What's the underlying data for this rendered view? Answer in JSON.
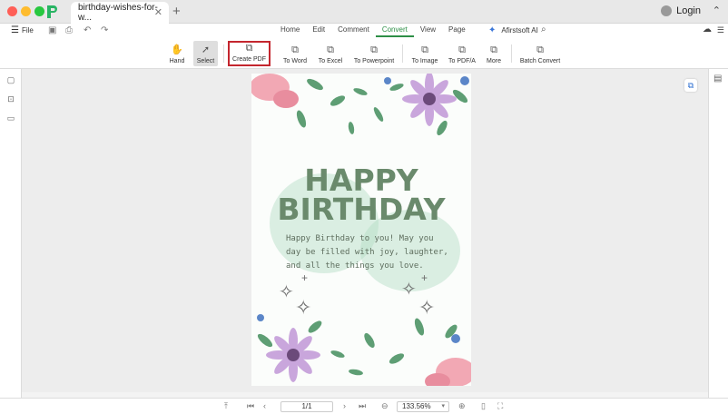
{
  "window": {
    "tab_title": "birthday-wishes-for-w...",
    "tab_close": "✕",
    "new_tab": "+",
    "login_label": "Login"
  },
  "menubar": {
    "file_label": "File",
    "tabs": [
      "Home",
      "Edit",
      "Comment",
      "Convert",
      "View",
      "Page"
    ],
    "active_tab": "Convert",
    "ai_label": "Afirstsoft AI"
  },
  "toolbar": {
    "tools": [
      {
        "label": "Hand",
        "icon": "hand-icon"
      },
      {
        "label": "Select",
        "icon": "cursor-icon"
      },
      {
        "label": "Create PDF",
        "icon": "create-pdf-icon"
      },
      {
        "label": "To Word",
        "icon": "word-icon"
      },
      {
        "label": "To Excel",
        "icon": "excel-icon"
      },
      {
        "label": "To Powerpoint",
        "icon": "powerpoint-icon"
      },
      {
        "label": "To Image",
        "icon": "image-icon"
      },
      {
        "label": "To PDF/A",
        "icon": "pdfa-icon"
      },
      {
        "label": "More",
        "icon": "more-icon"
      },
      {
        "label": "Batch Convert",
        "icon": "batch-icon"
      }
    ],
    "selected_tool": "Select",
    "highlighted_tool": "Create PDF"
  },
  "document": {
    "heading_line1": "HAPPY",
    "heading_line2": "BIRTHDAY",
    "message": "Happy Birthday to you! May you day be filled with joy, laughter, and all the things you love."
  },
  "footer": {
    "page_indicator": "1/1",
    "zoom": "133.56%"
  },
  "colors": {
    "accent": "#2d8f46",
    "highlight_border": "#c4262e",
    "heading_text": "#6a8a6c"
  }
}
